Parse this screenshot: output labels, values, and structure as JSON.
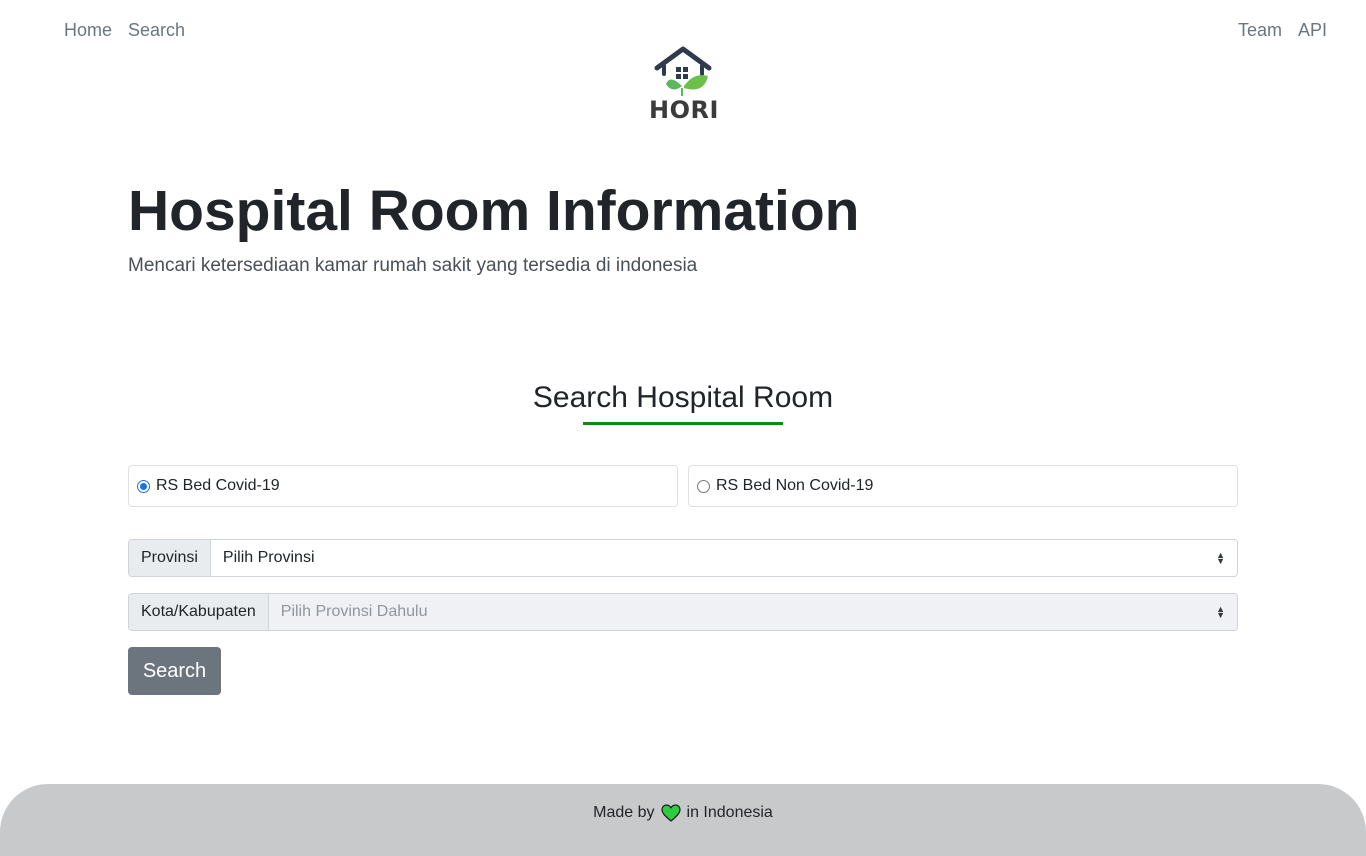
{
  "nav": {
    "left": [
      "Home",
      "Search"
    ],
    "right": [
      "Team",
      "API"
    ]
  },
  "logo": {
    "text": "HORI"
  },
  "hero": {
    "title": "Hospital Room Information",
    "subtitle": "Mencari ketersediaan kamar rumah sakit yang tersedia di indonesia"
  },
  "search": {
    "title": "Search Hospital Room",
    "radios": [
      {
        "label": "RS Bed Covid-19",
        "checked": true
      },
      {
        "label": "RS Bed Non Covid-19",
        "checked": false
      }
    ],
    "provinsi": {
      "label": "Provinsi",
      "selected": "Pilih Provinsi"
    },
    "kota": {
      "label": "Kota/Kabupaten",
      "selected": "Pilih Provinsi Dahulu"
    },
    "button_label": "Search"
  },
  "footer": {
    "prefix": "Made by",
    "suffix": "in Indonesia",
    "heart_color": "#2ecc40"
  },
  "colors": {
    "accent_underline": "#108a10",
    "button": "#6c757d",
    "footer_bg": "#c8c9cb"
  }
}
